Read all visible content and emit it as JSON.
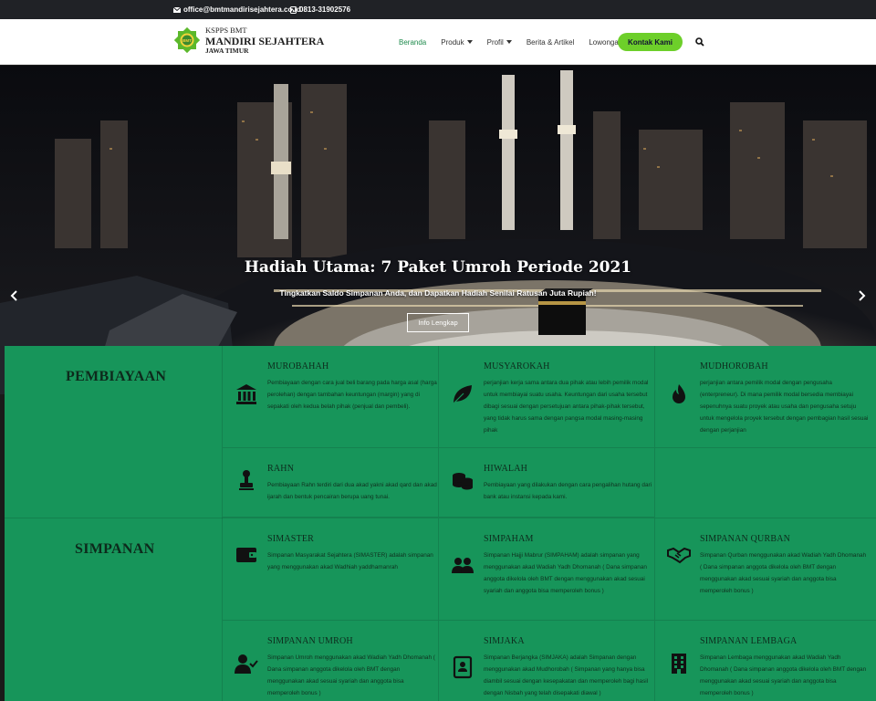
{
  "topbar": {
    "email": "office@bmtmandirisejahtera.co.id",
    "phone": "0813-31902576"
  },
  "brand": {
    "line1": "KSPPS BMT",
    "line2": "MANDIRI SEJAHTERA",
    "line3": "JAWA TIMUR"
  },
  "nav": {
    "items": [
      {
        "label": "Beranda",
        "active": true,
        "dropdown": false
      },
      {
        "label": "Produk",
        "active": false,
        "dropdown": true
      },
      {
        "label": "Profil",
        "active": false,
        "dropdown": true
      },
      {
        "label": "Berita & Artikel",
        "active": false,
        "dropdown": false
      },
      {
        "label": "Lowongan",
        "active": false,
        "dropdown": false
      }
    ],
    "cta": "Kontak Kami"
  },
  "hero": {
    "title": "Hadiah Utama: 7 Paket Umroh Periode 2021",
    "subtitle": "Tingkatkan Saldo Simpanan Anda, dan Dapatkan Hadiah Senilai Ratusan Juta Rupiah!",
    "button": "Info Lengkap"
  },
  "pembiayaan": {
    "title": "PEMBIAYAAN",
    "items": [
      {
        "icon": "bank-icon",
        "title": "MUROBAHAH",
        "desc": "Pembiayaan dengan cara jual beli barang pada harga asal (harga perolehan) dengan tambahan keuntungan (margin) yang di sepakati oleh kedua belah pihak (penjual dan pembeli)."
      },
      {
        "icon": "leaf-icon",
        "title": "MUSYAROKAH",
        "desc": "perjanjian kerja sama antara dua pihak atau lebih pemilik modal untuk membiayai suatu usaha. Keuntungan dari usaha tersebut dibagi sesuai dengan persetujuan antara pihak-pihak tersebut, yang tidak harus sama dengan pangsa modal masing-masing pihak"
      },
      {
        "icon": "flame-icon",
        "title": "MUDHOROBAH",
        "desc": "perjanjian antara pemilik modal dengan pengusaha (enterpreneur). Di mana pemilik modal bersedia membiayai sepenuhnya suatu proyek atau usaha dan pengusaha setuju untuk mengelola proyek tersebut dengan pembagian hasil sesuai dengan perjanjian"
      },
      {
        "icon": "stamp-icon",
        "title": "RAHN",
        "desc": "Pembiayaan Rahn terdiri dari dua akad yakni akad qard dan akad ijarah dan bentuk pencairan berupa uang tunai."
      },
      {
        "icon": "coins-icon",
        "title": "HIWALAH",
        "desc": "Pembiayaan yang dilakukan dengan cara pengalihan hutang dari bank atau instansi kepada kami."
      }
    ]
  },
  "simpanan": {
    "title": "SIMPANAN",
    "items": [
      {
        "icon": "wallet-icon",
        "title": "SIMASTER",
        "desc": "Simpanan Masyarakat Sejahtera (SIMASTER) adalah simpanan yang menggunakan akad Wadhiah yaddhamanrah"
      },
      {
        "icon": "users-icon",
        "title": "SIMPAHAM",
        "desc": "Simpanan Hajji Mabrur (SIMPAHAM) adalah simpanan yang menggunakan akad Wadiah Yadh Dhomanah ( Dana simpanan anggota dikelola oleh BMT dengan menggunakan akad sesuai syariah dan anggota bisa memperoleh bonus )"
      },
      {
        "icon": "handshake-icon",
        "title": "SIMPANAN QURBAN",
        "desc": "Simpanan Qurban menggunakan akad Wadiah Yadh Dhomanah ( Dana simpanan anggota dikelola oleh BMT dengan menggunakan akad sesuai syariah dan anggota bisa memperoleh bonus )"
      },
      {
        "icon": "user-check-icon",
        "title": "SIMPANAN UMROH",
        "desc": "Simpanan Umroh menggunakan akad Wadiah Yadh Dhomanah ( Dana simpanan anggota dikelola oleh BMT dengan menggunakan akad sesuai syariah dan anggota bisa memperoleh bonus )"
      },
      {
        "icon": "contact-book-icon",
        "title": "SIMJAKA",
        "desc": "Simpanan Berjangka (SIMJAKA) adalah Simpanan dengan menggunakan akad Mudhorobah ( Simpanan yang hanya bisa diambil sesuai dengan kesepakatan dan memperoleh bagi hasil dengan Nisbah yang telah disepakati diawal )"
      },
      {
        "icon": "building-icon",
        "title": "SIMPANAN LEMBAGA",
        "desc": "Simpanan Lembaga menggunakan akad Wadiah Yadh Dhomanah ( Dana simpanan anggota dikelola oleh BMT dengan menggunakan akad sesuai syariah dan anggota bisa memperoleh bonus )"
      }
    ]
  },
  "colors": {
    "accent_green": "#17955a",
    "cta_green": "#6dcf2a",
    "nav_active": "#1e8a4c",
    "topbar": "#202226"
  }
}
